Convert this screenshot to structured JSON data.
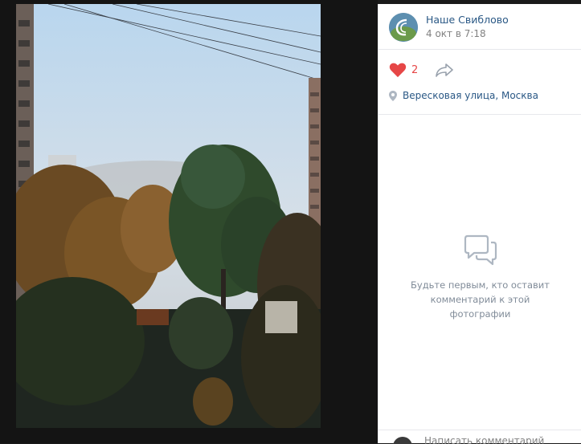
{
  "post": {
    "group_name": "Наше Свиблово",
    "date": "4 окт в 7:18",
    "likes": "2",
    "location": "Вересковая улица, Москва"
  },
  "comments": {
    "empty_text": "Будьте первым, кто оставит комментарий к этой фотографии",
    "footer_text": "Написать комментарий"
  },
  "colors": {
    "link": "#2a5885",
    "like": "#e64646",
    "muted": "#828282",
    "viewer_bg": "#141414"
  },
  "icons": [
    "heart-icon",
    "share-icon",
    "location-pin-icon",
    "comment-bubbles-icon"
  ]
}
